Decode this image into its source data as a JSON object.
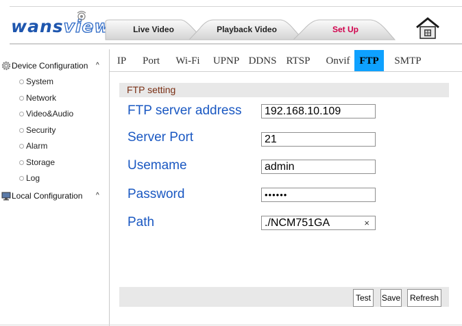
{
  "header": {
    "logo_a": "wans",
    "logo_b": "view",
    "tabs": [
      {
        "label": "Live Video",
        "state": "inactive"
      },
      {
        "label": "Playback Video",
        "state": "inactive"
      },
      {
        "label": "Set Up",
        "state": "active"
      }
    ],
    "home_icon": "home-icon"
  },
  "colors": {
    "brand": "#1e56ae",
    "active_tab_fill": "#0ea1ff",
    "setup_tab_text": "#d1004c",
    "label_blue": "#1a58c2",
    "section_title": "#7a2f14",
    "panel_gray": "#e8e8e8"
  },
  "sidebar": {
    "device_config": {
      "label": "Device Configuration",
      "caret": "^",
      "icon": "gear-icon"
    },
    "items": [
      {
        "label": "System"
      },
      {
        "label": "Network"
      },
      {
        "label": "Video&Audio"
      },
      {
        "label": "Security"
      },
      {
        "label": "Alarm"
      },
      {
        "label": "Storage"
      },
      {
        "label": "Log"
      }
    ],
    "local_config": {
      "label": "Local Configuration",
      "caret": "^",
      "icon": "monitor-icon"
    }
  },
  "subtabs": [
    {
      "label": "IP"
    },
    {
      "label": "Port"
    },
    {
      "label": "Wi-Fi"
    },
    {
      "label": "UPNP"
    },
    {
      "label": "DDNS"
    },
    {
      "label": "RTSP"
    },
    {
      "label": "Onvif"
    },
    {
      "label": "FTP",
      "active": true
    },
    {
      "label": "SMTP"
    }
  ],
  "ftp": {
    "section_title": "FTP setting",
    "fields": [
      {
        "label": "FTP server address",
        "value": "192.168.10.109"
      },
      {
        "label": "Server Port",
        "value": "21"
      },
      {
        "label": "Usemame",
        "value": "admin"
      },
      {
        "label": "Password",
        "value": "••••••"
      },
      {
        "label": "Path",
        "value": "./NCM751GA",
        "clear": "×"
      }
    ]
  },
  "buttons": {
    "test": "Test",
    "save": "Save",
    "refresh": "Refresh"
  }
}
